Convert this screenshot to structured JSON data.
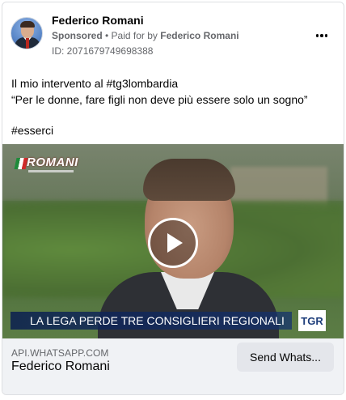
{
  "header": {
    "page_name": "Federico Romani",
    "sponsored_label": "Sponsored",
    "separator": " • ",
    "paid_for_prefix": "Paid for by ",
    "paid_for_name": "Federico Romani",
    "ad_id": "ID: 2071679749698388"
  },
  "post": {
    "line1": "Il mio intervento al #tg3lombardia",
    "line2": "“Per le donne, fare figli non deve più essere solo un sogno”",
    "line3": "#esserci"
  },
  "video": {
    "logo_text": "ROMANI",
    "ticker_text": "LA LEGA PERDE TRE CONSIGLIERI REGIONALI",
    "channel_badge": "TGR"
  },
  "footer": {
    "domain": "API.WHATSAPP.COM",
    "title": "Federico Romani",
    "cta_label": "Send Whats..."
  },
  "icons": {
    "more": "more-horizontal-icon",
    "play": "play-icon"
  }
}
